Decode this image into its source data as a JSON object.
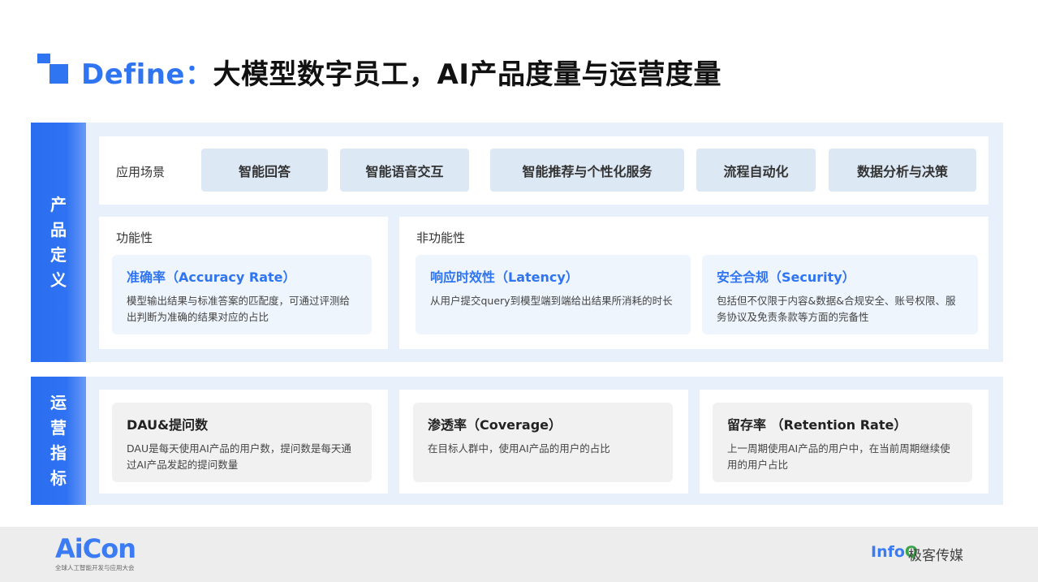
{
  "header": {
    "title_en": "Define：",
    "title_cn": "大模型数字员工，AI产品度量与运营度量"
  },
  "product": {
    "side_label": [
      "产",
      "品",
      "定",
      "义"
    ],
    "scenario_label": "应用场景",
    "scenarios": [
      "智能回答",
      "智能语音交互",
      "智能推荐与个性化服务",
      "流程自动化",
      "数据分析与决策"
    ],
    "functional_label": "功能性",
    "nonfunctional_label": "非功能性",
    "functional_cards": [
      {
        "title": "准确率（Accuracy Rate）",
        "desc": "模型输出结果与标准答案的匹配度，可通过评测给出判断为准确的结果对应的占比"
      }
    ],
    "nonfunctional_cards": [
      {
        "title": "响应时效性（Latency）",
        "desc": "从用户提交query到模型端到端给出结果所消耗的时长"
      },
      {
        "title": "安全合规（Security）",
        "desc": "包括但不仅限于内容&数据&合规安全、账号权限、服务协议及免责条款等方面的完备性"
      }
    ]
  },
  "ops": {
    "side_label": [
      "运",
      "营",
      "指",
      "标"
    ],
    "cards": [
      {
        "title": "DAU&提问数",
        "desc": "DAU是每天使用AI产品的用户数，提问数是每天通过AI产品发起的提问数量"
      },
      {
        "title": "渗透率（Coverage）",
        "desc": "在目标人群中，使用AI产品的用户的占比"
      },
      {
        "title": "留存率 （Retention Rate）",
        "desc": "上一周期使用AI产品的用户中，在当前周期继续使用的用户占比"
      }
    ]
  },
  "footer": {
    "aicon": "AiCon",
    "aicon_sub": "全球人工智能开发与应用大会",
    "infoq_a": "Info",
    "infoq_b": "Q",
    "jike": "极客传媒"
  },
  "colors": {
    "accent": "#2f74f0",
    "panel": "#e8f0fc",
    "pill": "#dde8f5"
  }
}
